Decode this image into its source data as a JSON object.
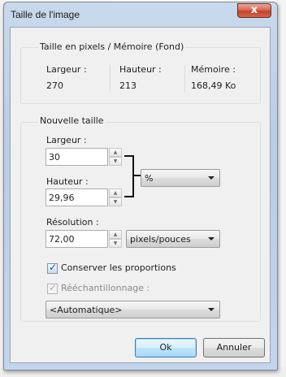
{
  "window": {
    "title": "Taille de l'image",
    "close_label": "x"
  },
  "current": {
    "group_label": "Taille en pixels / Mémoire (Fond)",
    "width_label": "Largeur :",
    "width_value": "270",
    "height_label": "Hauteur :",
    "height_value": "213",
    "memory_label": "Mémoire :",
    "memory_value": "168,49 Ko"
  },
  "new_size": {
    "group_label": "Nouvelle taille",
    "width_label": "Largeur :",
    "width_value": "30",
    "height_label": "Hauteur :",
    "height_value": "29,96",
    "unit_selected": "%",
    "resolution_label": "Résolution :",
    "resolution_value": "72,00",
    "resolution_unit_selected": "pixels/pouces"
  },
  "options": {
    "keep_ratio_label": "Conserver les proportions",
    "keep_ratio_checked": true,
    "resample_label": "Rééchantillonnage :",
    "resample_checked": true,
    "resample_enabled": false,
    "resample_method_selected": "<Automatique>"
  },
  "buttons": {
    "ok_label": "Ok",
    "cancel_label": "Annuler"
  },
  "icons": {
    "close": "close-icon",
    "spin_up": "spin-up-icon",
    "spin_down": "spin-down-icon",
    "dropdown": "chevron-down-icon",
    "check": "checkmark-icon"
  },
  "colors": {
    "close_button": "#c2432b",
    "title_bar": "#c3d5ea",
    "dialog_bg": "#f0f0f0",
    "default_button_border": "#3c7fb1"
  }
}
